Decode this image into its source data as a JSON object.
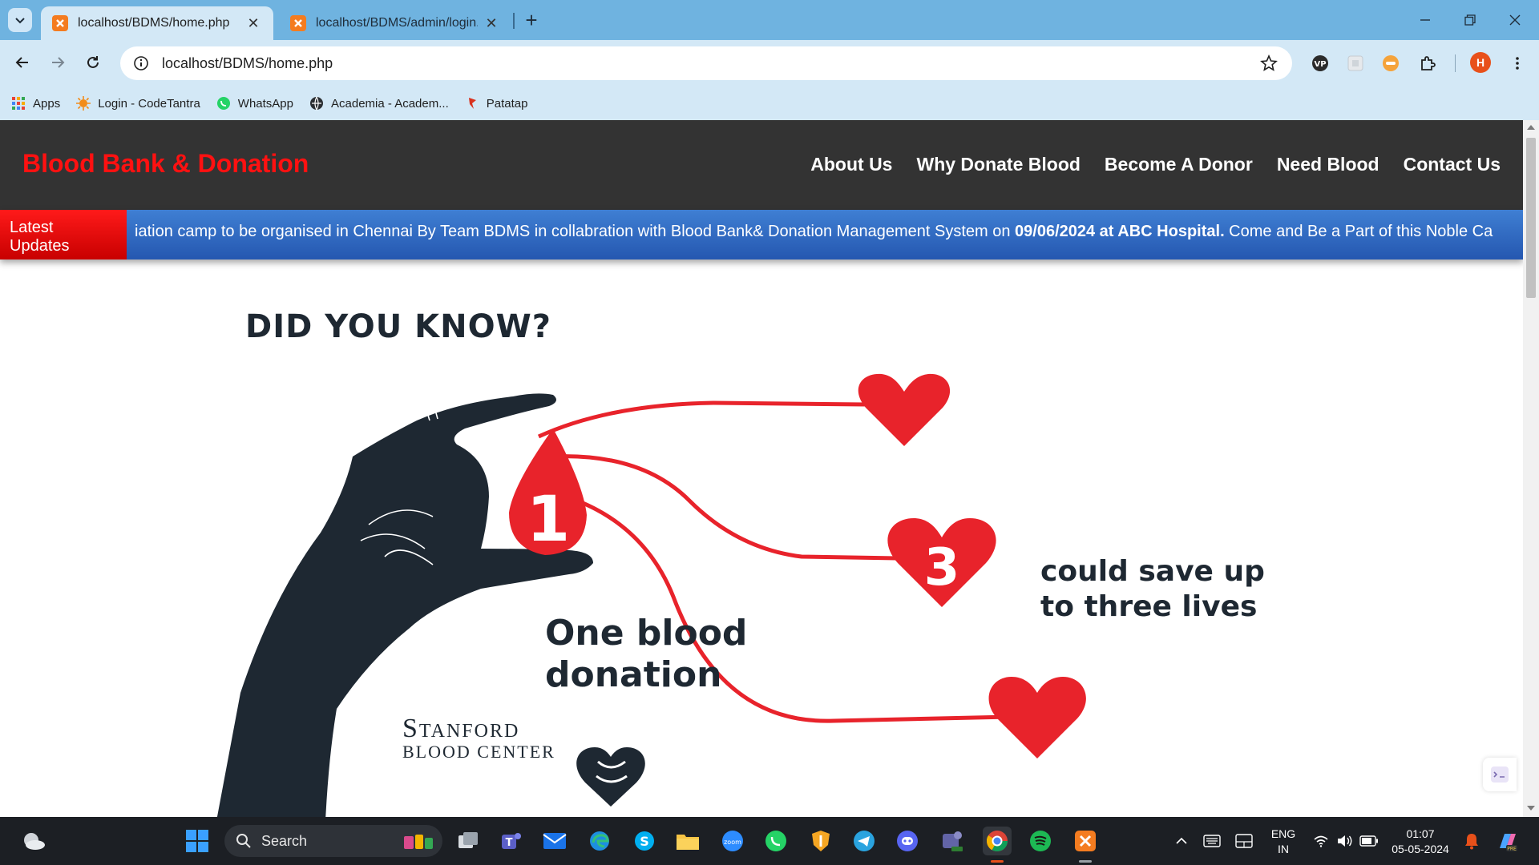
{
  "browser": {
    "tabs": [
      {
        "title": "localhost/BDMS/home.php",
        "active": true
      },
      {
        "title": "localhost/BDMS/admin/login.php",
        "active": false
      }
    ],
    "url": "localhost/BDMS/home.php",
    "profile_initial": "H",
    "bookmarks": [
      {
        "label": "Apps",
        "icon": "apps-grid-icon"
      },
      {
        "label": "Login - CodeTantra",
        "icon": "codetantra-icon"
      },
      {
        "label": "WhatsApp",
        "icon": "whatsapp-icon"
      },
      {
        "label": "Academia - Academ...",
        "icon": "academia-icon"
      },
      {
        "label": "Patatap",
        "icon": "patatap-icon"
      }
    ]
  },
  "site": {
    "brand": "Blood Bank & Donation",
    "nav": [
      "About Us",
      "Why Donate Blood",
      "Become A Donor",
      "Need Blood",
      "Contact Us"
    ],
    "ticker": {
      "label": "Latest Updates",
      "text_before": "iation camp to be organised in Chennai By Team BDMS in collabration with Blood Bank& Donation Management System on ",
      "text_bold": "09/06/2024 at ABC Hospital.",
      "text_after": " Come and Be a Part of this Noble Ca"
    },
    "infographic": {
      "title": "DID YOU KNOW?",
      "drop_number": "1",
      "heart_number": "3",
      "line_one": "One blood",
      "line_two": "donation",
      "save_line_one": "could save up",
      "save_line_two": "to three lives",
      "logo_line_one": "Stanford",
      "logo_line_two": "BLOOD CENTER"
    }
  },
  "taskbar": {
    "search_placeholder": "Search",
    "language": "ENG",
    "region": "IN",
    "time": "01:07",
    "date": "05-05-2024"
  },
  "colors": {
    "accent_red": "#ff1111",
    "header_bg": "#333333",
    "ticker_blue": "#2f6bc4",
    "heart_red": "#e8232b",
    "ink": "#1e2832"
  }
}
